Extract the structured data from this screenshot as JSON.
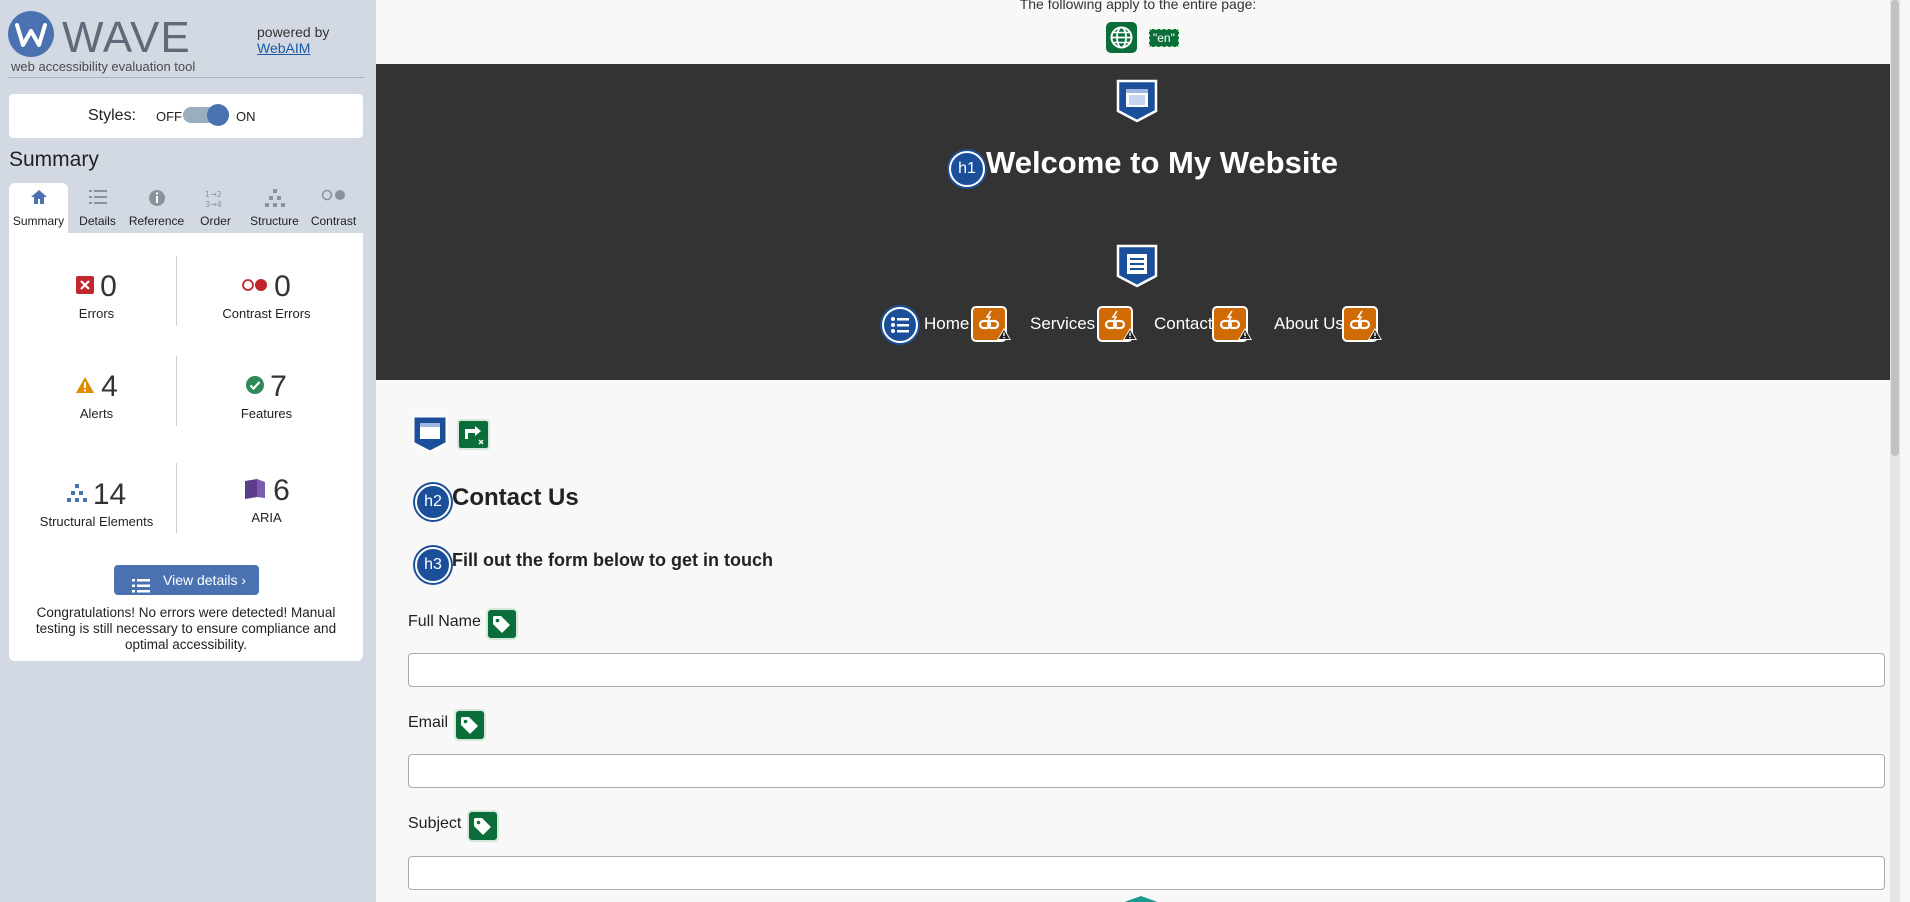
{
  "wave": {
    "logo_text": "WAVE",
    "tagline": "web accessibility evaluation tool",
    "powered_by": "powered by",
    "powered_link": "WebAIM",
    "styles_label": "Styles:",
    "styles_off": "OFF",
    "styles_on": "ON",
    "summary_title": "Summary",
    "tabs": [
      {
        "label": "Summary",
        "icon": "home-icon",
        "active": true
      },
      {
        "label": "Details",
        "icon": "list-icon"
      },
      {
        "label": "Reference",
        "icon": "info-icon"
      },
      {
        "label": "Order",
        "icon": "order-icon"
      },
      {
        "label": "Structure",
        "icon": "structure-icon"
      },
      {
        "label": "Contrast",
        "icon": "contrast-icon"
      }
    ],
    "stats": {
      "errors": {
        "value": "0",
        "label": "Errors",
        "color": "#c0272d"
      },
      "contrast_errors": {
        "value": "0",
        "label": "Contrast Errors",
        "color": "#c0272d"
      },
      "alerts": {
        "value": "4",
        "label": "Alerts",
        "color": "#e08a00"
      },
      "features": {
        "value": "7",
        "label": "Features",
        "color": "#2e8b57"
      },
      "structural": {
        "value": "14",
        "label": "Structural Elements",
        "color": "#4b72b0"
      },
      "aria": {
        "value": "6",
        "label": "ARIA",
        "color": "#5b3d8a"
      }
    },
    "view_details": "View details ›",
    "congrats": "Congratulations! No errors were detected! Manual testing is still necessary to ensure compliance and optimal accessibility."
  },
  "page": {
    "apply_text": "The following apply to the entire page:",
    "lang": "\"en\"",
    "h1_badge": "h1",
    "h1": "Welcome to My Website",
    "nav": [
      "Home",
      "Services",
      "Contact",
      "About Us"
    ],
    "h2_badge": "h2",
    "h2": "Contact Us",
    "h3_badge": "h3",
    "h3": "Fill out the form below to get in touch",
    "fields": [
      {
        "label": "Full Name",
        "value": ""
      },
      {
        "label": "Email",
        "value": ""
      },
      {
        "label": "Subject",
        "value": ""
      }
    ]
  },
  "colors": {
    "wave_blue": "#4b72b0",
    "sidebar_bg": "#d3d9e2",
    "header_bg": "#333333",
    "feature_green": "#0b6e3a",
    "alert_orange": "#d06a05",
    "structure_navy": "#1c4f99"
  }
}
